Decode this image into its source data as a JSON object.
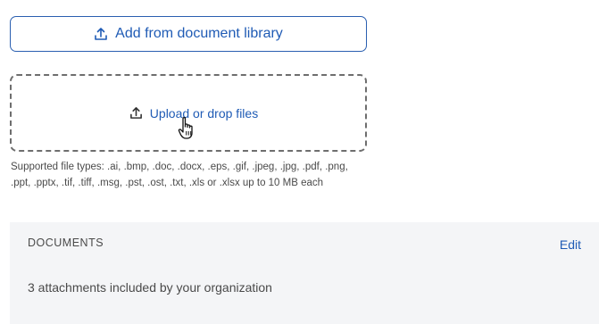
{
  "add_library_button": {
    "label": "Add from document library",
    "icon": "upload-icon"
  },
  "dropzone": {
    "label": "Upload or drop files",
    "icon": "upload-icon"
  },
  "supported_types_text": "Supported file types: .ai, .bmp, .doc, .docx, .eps, .gif, .jpeg, .jpg, .pdf, .png, .ppt, .pptx, .tif, .tiff, .msg, .pst, .ost, .txt, .xls or .xlsx up to 10 MB each",
  "documents_panel": {
    "title": "DOCUMENTS",
    "edit_label": "Edit",
    "summary": "3 attachments included by your organization"
  },
  "colors": {
    "accent": "#1f5bb5",
    "panel_bg": "#f4f5f7",
    "text": "#4a4a4a"
  }
}
